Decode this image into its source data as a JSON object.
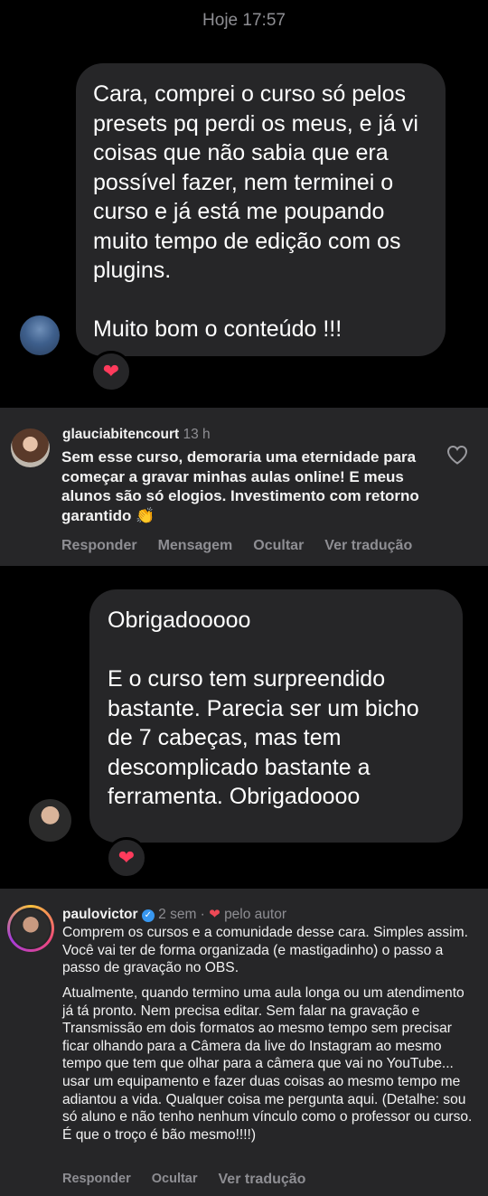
{
  "timestamp": "Hoje 17:57",
  "messages": [
    {
      "text": "Cara, comprei o curso só pelos presets pq perdi os meus, e já vi coisas que não sabia que era possível fazer, nem terminei o curso e já está me poupando muito tempo de edição com os plugins.\n\nMuito bom o conteúdo !!!",
      "reaction_icon": "heart-emoji",
      "reaction": "❤"
    },
    {
      "text": "Obrigadooooo\n\nE o curso tem surpreendido bastante. Parecia ser um bicho de 7 cabeças, mas tem descomplicado bastante a ferramenta. Obrigadoooo",
      "reaction_icon": "heart-emoji",
      "reaction": "❤"
    }
  ],
  "comments": [
    {
      "username": "glauciabitencourt",
      "time": "13 h",
      "text": "Sem esse curso, demoraria uma eternidade para começar a gravar minhas aulas online! E meus alunos são só elogios. Investimento com retorno garantido 👏",
      "actions": [
        "Responder",
        "Mensagem",
        "Ocultar",
        "Ver tradução"
      ]
    },
    {
      "username": "paulovictor",
      "time": "2 sem ·",
      "author_badge": "pelo autor",
      "text_p1": "Comprem os cursos e a comunidade desse cara. Simples assim. Você vai ter de forma organizada (e mastigadinho) o passo a passo de gravação no OBS.",
      "text_p2": "Atualmente, quando termino uma aula longa ou um atendimento já tá pronto. Nem precisa editar. Sem falar na gravação e Transmissão em dois formatos ao mesmo tempo sem precisar ficar olhando para a Câmera da live do Instagram ao mesmo tempo que tem que olhar para a câmera que vai no YouTube... usar um equipamento e fazer duas coisas ao mesmo tempo me adiantou a vida. Qualquer coisa me pergunta aqui. (Detalhe: sou só aluno e não tenho nenhum vínculo como o professor ou curso. É que o troço é bão mesmo!!!!)",
      "actions": [
        "Responder",
        "Ocultar",
        "Ver tradução"
      ]
    }
  ]
}
